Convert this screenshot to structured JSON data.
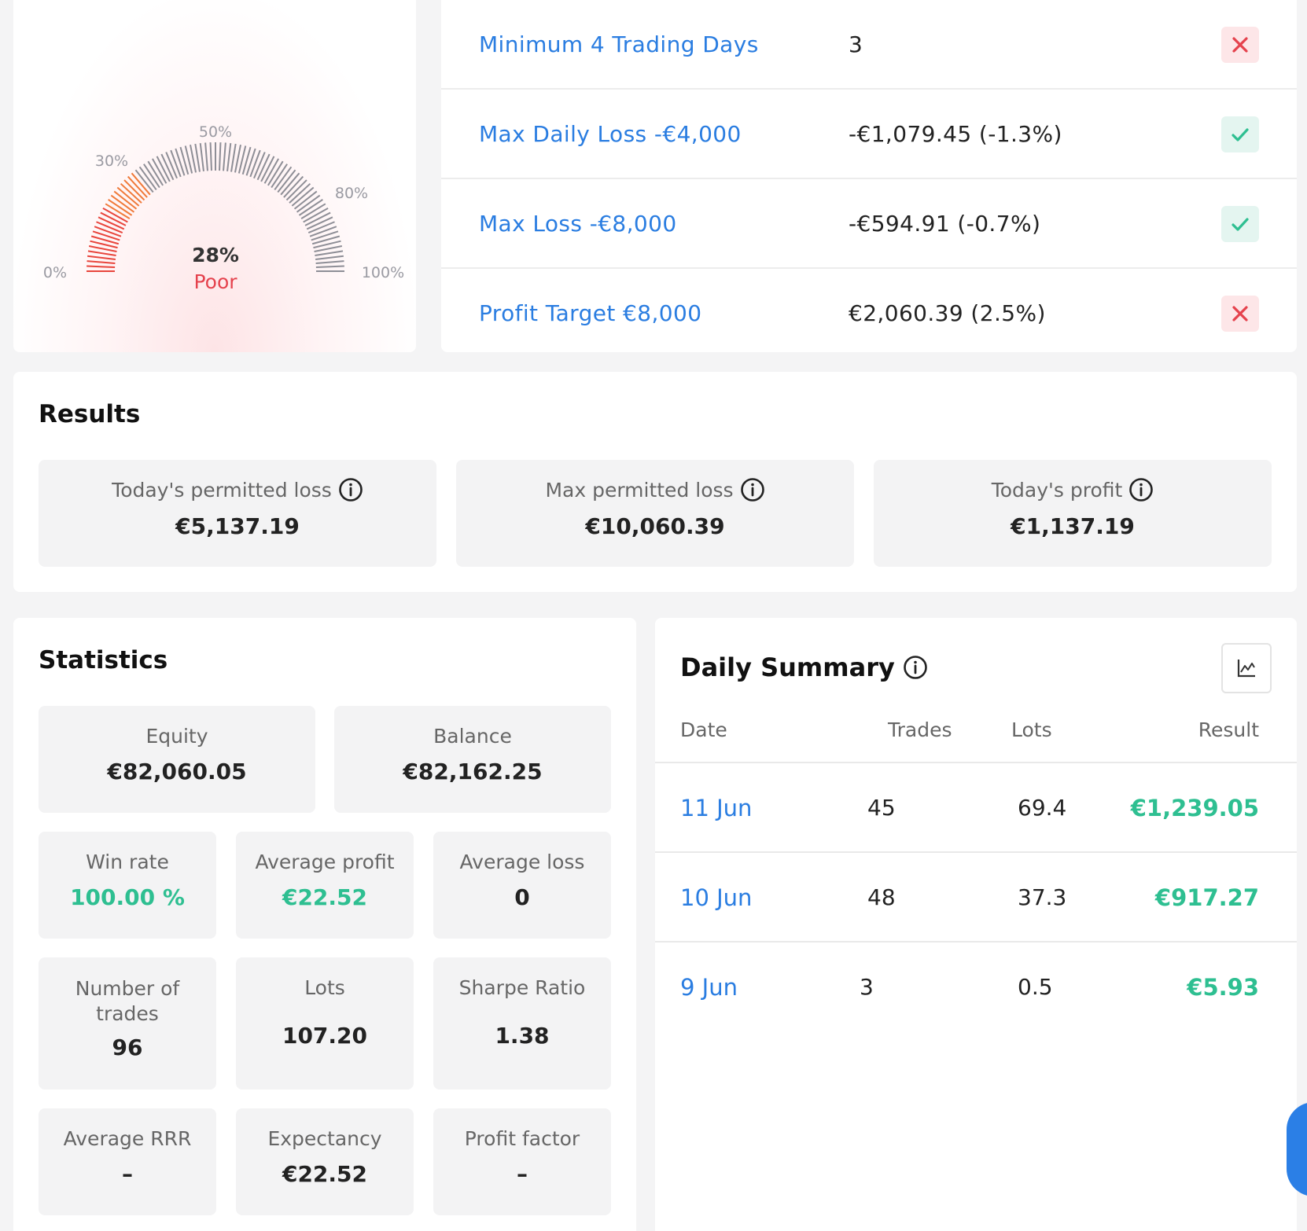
{
  "gauge": {
    "percent_label": "28%",
    "rating": "Poor",
    "value": 28,
    "tick_labels": [
      "0%",
      "30%",
      "50%",
      "80%",
      "100%"
    ]
  },
  "objectives": [
    {
      "name": "Minimum 4 Trading Days",
      "value": "3",
      "status": "fail",
      "icon": "close-icon"
    },
    {
      "name": "Max Daily Loss -€4,000",
      "value": "-€1,079.45 (-1.3%)",
      "status": "pass",
      "icon": "check-icon"
    },
    {
      "name": "Max Loss -€8,000",
      "value": "-€594.91 (-0.7%)",
      "status": "pass",
      "icon": "check-icon"
    },
    {
      "name": "Profit Target €8,000",
      "value": "€2,060.39 (2.5%)",
      "status": "fail",
      "icon": "close-icon"
    }
  ],
  "results": {
    "title": "Results",
    "tiles": [
      {
        "label": "Today's permitted loss",
        "value": "€5,137.19"
      },
      {
        "label": "Max permitted loss",
        "value": "€10,060.39"
      },
      {
        "label": "Today's profit",
        "value": "€1,137.19"
      }
    ]
  },
  "statistics": {
    "title": "Statistics",
    "equity": {
      "label": "Equity",
      "value": "€82,060.05"
    },
    "balance": {
      "label": "Balance",
      "value": "€82,162.25"
    },
    "win_rate": {
      "label": "Win rate",
      "value": "100.00 %"
    },
    "avg_profit": {
      "label": "Average profit",
      "value": "€22.52"
    },
    "avg_loss": {
      "label": "Average loss",
      "value": "0"
    },
    "num_trades": {
      "label": "Number of trades",
      "value": "96"
    },
    "lots": {
      "label": "Lots",
      "value": "107.20"
    },
    "sharpe": {
      "label": "Sharpe Ratio",
      "value": "1.38"
    },
    "avg_rrr": {
      "label": "Average RRR",
      "value": "–"
    },
    "expectancy": {
      "label": "Expectancy",
      "value": "€22.52"
    },
    "profit_factor": {
      "label": "Profit factor",
      "value": "–"
    }
  },
  "daily_summary": {
    "title": "Daily Summary",
    "columns": {
      "date": "Date",
      "trades": "Trades",
      "lots": "Lots",
      "result": "Result"
    },
    "rows": [
      {
        "date": "11 Jun",
        "trades": "45",
        "lots": "69.4",
        "result": "€1,239.05"
      },
      {
        "date": "10 Jun",
        "trades": "48",
        "lots": "37.3",
        "result": "€917.27"
      },
      {
        "date": "9 Jun",
        "trades": "3",
        "lots": "0.5",
        "result": "€5.93"
      }
    ]
  },
  "colors": {
    "link_blue": "#2a7de1",
    "success_green": "#2ebf91",
    "danger_red": "#e5424d",
    "gauge_red": "#e8453c",
    "gauge_orange": "#f07a3a",
    "gauge_grey": "#8e8e96"
  }
}
